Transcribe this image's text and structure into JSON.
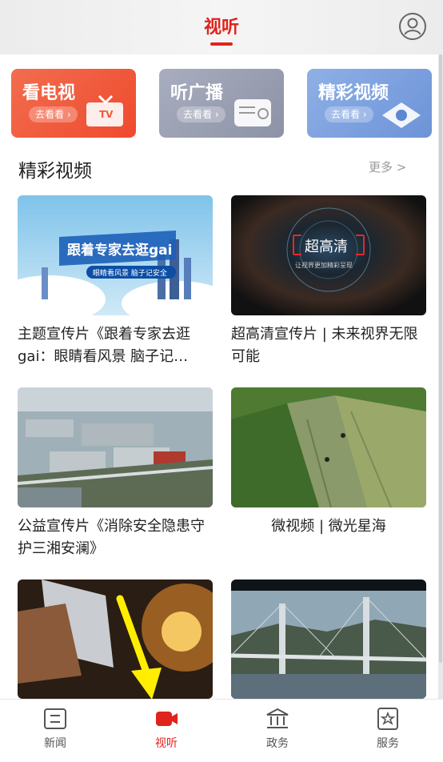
{
  "header": {
    "title": "视听"
  },
  "categories": [
    {
      "name": "看电视",
      "action": "去看看 ›"
    },
    {
      "name": "听广播",
      "action": "去看看 ›"
    },
    {
      "name": "精彩视频",
      "action": "去看看 ›"
    }
  ],
  "section": {
    "title": "精彩视频",
    "more": "更多 >"
  },
  "videos": [
    {
      "title": "主题宣传片《跟着专家去逛gai：眼睛看风景 脑子记…",
      "thumb_text": "跟着专家去逛gai",
      "thumb_sub": "眼睛看风景 脑子记安全"
    },
    {
      "title": "超高清宣传片 | 未来视界无限可能",
      "thumb_text": "超高清",
      "thumb_sub": "让视界更加精彩呈现"
    },
    {
      "title": "公益宣传片《消除安全隐患守护三湘安澜》"
    },
    {
      "title": "微视频 | 微光星海"
    },
    {
      "title": ""
    },
    {
      "title": ""
    }
  ],
  "bottomnav": [
    {
      "label": "新闻",
      "icon": "news-icon"
    },
    {
      "label": "视听",
      "icon": "video-camera-icon"
    },
    {
      "label": "政务",
      "icon": "government-icon"
    },
    {
      "label": "服务",
      "icon": "service-icon"
    }
  ],
  "colors": {
    "accent": "#e0231c",
    "overlay_arrow": "#ffee00"
  }
}
